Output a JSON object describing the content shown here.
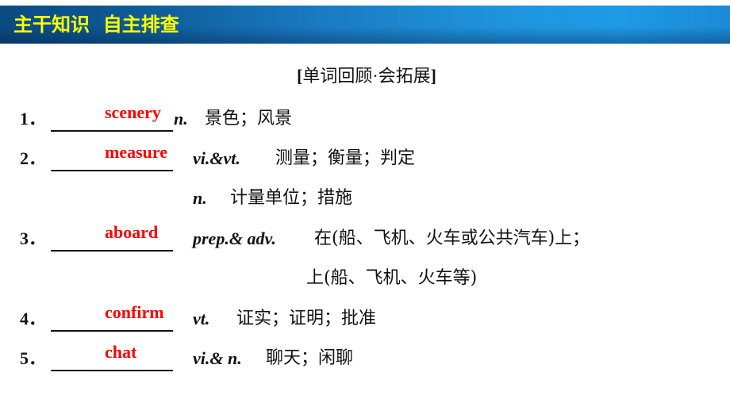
{
  "header": {
    "title": "主干知识  自主排查",
    "colors": {
      "bar_dark": "#0b4a80",
      "bar_light": "#1f95de",
      "title_text": "#ffff00"
    }
  },
  "section": {
    "bracket_open": "[",
    "heading": "单词回顾·会拓展",
    "bracket_close": "]"
  },
  "answer_color": "#ff0000",
  "items": [
    {
      "number": "1．",
      "answer": "scenery",
      "senses": [
        {
          "pos": "n.",
          "definition": "景色；风景"
        }
      ]
    },
    {
      "number": "2．",
      "answer": "measure",
      "senses": [
        {
          "pos": "vi.&vt.",
          "definition": "测量；衡量；判定"
        },
        {
          "pos": "n.",
          "definition": "计量单位；措施"
        }
      ]
    },
    {
      "number": "3．",
      "answer": "aboard",
      "senses": [
        {
          "pos": "prep.& adv.",
          "definition": "在(船、飞机、火车或公共汽车)上；",
          "continuation": "上(船、飞机、火车等)"
        }
      ]
    },
    {
      "number": "4．",
      "answer": "confirm",
      "senses": [
        {
          "pos": "vt.",
          "definition": "证实；证明；批准"
        }
      ]
    },
    {
      "number": "5．",
      "answer": "chat",
      "senses": [
        {
          "pos": "vi.& n.",
          "definition": "聊天；闲聊"
        }
      ]
    }
  ]
}
